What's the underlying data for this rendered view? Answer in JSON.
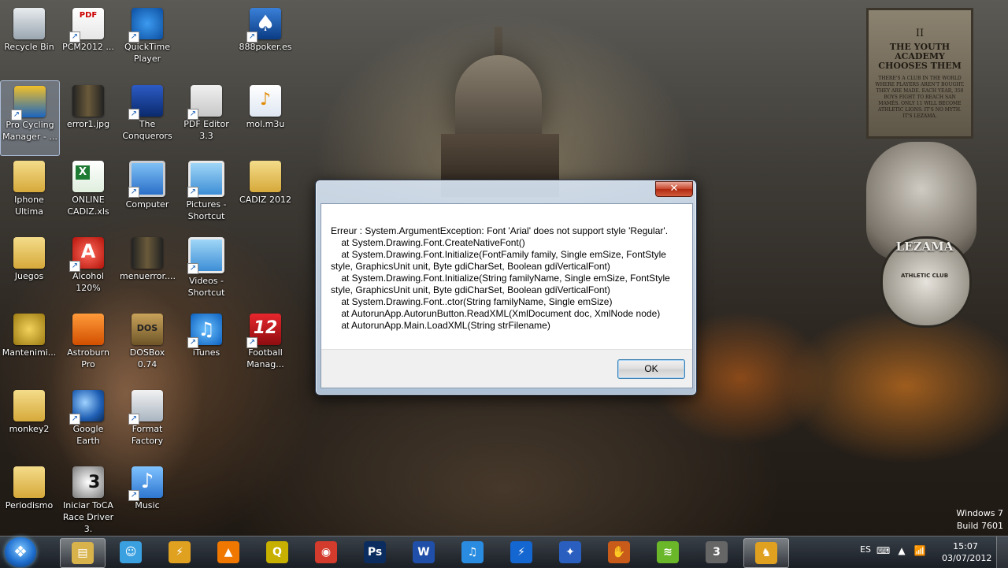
{
  "wallpaper": {
    "crest_roman": "II",
    "crest_title": "THE YOUTH ACADEMY CHOOSES THEM",
    "crest_body": "THERE'S A CLUB IN THE WORLD WHERE PLAYERS AREN'T BOUGHT. THEY ARE MADE. EACH YEAR, 350 BOYS FIGHT TO REACH SAN MAMÉS. ONLY 11 WILL BECOME ATHLETIC LIONS. IT'S NO MYTH. IT'S LEZAMA.",
    "badge_text": "LEZAMA",
    "badge_sub": "ATHLETIC CLUB"
  },
  "watermark": {
    "line1": "Windows 7",
    "line2": "Build 7601"
  },
  "desktop_icons": [
    {
      "label": "Recycle Bin",
      "icon": "recycle-bin-icon"
    },
    {
      "label": "PCM2012 ...",
      "icon": "pdf-icon"
    },
    {
      "label": "QuickTime Player",
      "icon": "quicktime-icon"
    },
    {
      "label": "888poker.es",
      "icon": "poker-icon"
    },
    {
      "label": "Pro Cycling Manager - ...",
      "icon": "cycling-icon"
    },
    {
      "label": "error1.jpg",
      "icon": "image-file-icon"
    },
    {
      "label": "The Conquerors",
      "icon": "conquerors-icon"
    },
    {
      "label": "PDF Editor 3.3",
      "icon": "pdf-editor-icon"
    },
    {
      "label": "mol.m3u",
      "icon": "playlist-icon"
    },
    {
      "label": "Iphone Ultima",
      "icon": "folder-icon"
    },
    {
      "label": "ONLINE CADIZ.xls",
      "icon": "excel-icon"
    },
    {
      "label": "Computer",
      "icon": "computer-icon"
    },
    {
      "label": "Pictures - Shortcut",
      "icon": "pictures-icon"
    },
    {
      "label": "CADIZ 2012",
      "icon": "folder-icon"
    },
    {
      "label": "Juegos",
      "icon": "folder-icon"
    },
    {
      "label": "Alcohol 120%",
      "icon": "alcohol-icon"
    },
    {
      "label": "menuerror....",
      "icon": "image-file-icon"
    },
    {
      "label": "Videos - Shortcut",
      "icon": "videos-icon"
    },
    {
      "label": "Mantenimi...",
      "icon": "keys-icon"
    },
    {
      "label": "Astroburn Pro",
      "icon": "astroburn-icon"
    },
    {
      "label": "DOSBox 0.74",
      "icon": "dosbox-icon"
    },
    {
      "label": "iTunes",
      "icon": "itunes-icon"
    },
    {
      "label": "Football Manag...",
      "icon": "football-manager-icon"
    },
    {
      "label": "monkey2",
      "icon": "folder-icon"
    },
    {
      "label": "Google Earth",
      "icon": "google-earth-icon"
    },
    {
      "label": "Format Factory",
      "icon": "format-factory-icon"
    },
    {
      "label": "Periodismo",
      "icon": "folder-icon"
    },
    {
      "label": "Iniciar ToCA Race Driver 3.",
      "icon": "toca-icon"
    },
    {
      "label": "Music",
      "icon": "music-icon"
    }
  ],
  "dialog": {
    "close_label": "✕",
    "message": "Erreur : System.ArgumentException: Font 'Arial' does not support style 'Regular'.\n    at System.Drawing.Font.CreateNativeFont()\n    at System.Drawing.Font.Initialize(FontFamily family, Single emSize, FontStyle style, GraphicsUnit unit, Byte gdiCharSet, Boolean gdiVerticalFont)\n    at System.Drawing.Font.Initialize(String familyName, Single emSize, FontStyle style, GraphicsUnit unit, Byte gdiCharSet, Boolean gdiVerticalFont)\n    at System.Drawing.Font..ctor(String familyName, Single emSize)\n    at AutorunApp.AutorunButton.ReadXML(XmlDocument doc, XmlNode node)\n    at AutorunApp.Main.LoadXML(String strFilename)",
    "ok_label": "OK"
  },
  "taskbar": {
    "pinned": [
      {
        "name": "explorer",
        "glyph": "▤",
        "color": "#d8b24a",
        "active": true
      },
      {
        "name": "messenger",
        "glyph": "☺",
        "color": "#3aa0e0",
        "active": false
      },
      {
        "name": "media-tool",
        "glyph": "⚡",
        "color": "#e0a020",
        "active": false
      },
      {
        "name": "vlc",
        "glyph": "▲",
        "color": "#f07800",
        "active": false
      },
      {
        "name": "app-yellow",
        "glyph": "Q",
        "color": "#c8b000",
        "active": false
      },
      {
        "name": "chrome",
        "glyph": "◉",
        "color": "#d33b2c",
        "active": false
      },
      {
        "name": "photoshop",
        "glyph": "Ps",
        "color": "#0a2c5e",
        "active": false
      },
      {
        "name": "word",
        "glyph": "W",
        "color": "#1f4fa8",
        "active": false
      },
      {
        "name": "itunes",
        "glyph": "♫",
        "color": "#2a8ce0",
        "active": false
      },
      {
        "name": "thunder",
        "glyph": "⚡",
        "color": "#1466d0",
        "active": false
      },
      {
        "name": "bird-app",
        "glyph": "✦",
        "color": "#2a5fc0",
        "active": false
      },
      {
        "name": "glove-app",
        "glyph": "✋",
        "color": "#c85a1a",
        "active": false
      },
      {
        "name": "spotify",
        "glyph": "≋",
        "color": "#6ab72a",
        "active": false
      },
      {
        "name": "toca",
        "glyph": "3",
        "color": "#666666",
        "active": false
      },
      {
        "name": "cycling",
        "glyph": "♞",
        "color": "#e0a020",
        "active": true
      }
    ],
    "lang": "ES",
    "time": "15:07",
    "date": "03/07/2012"
  }
}
